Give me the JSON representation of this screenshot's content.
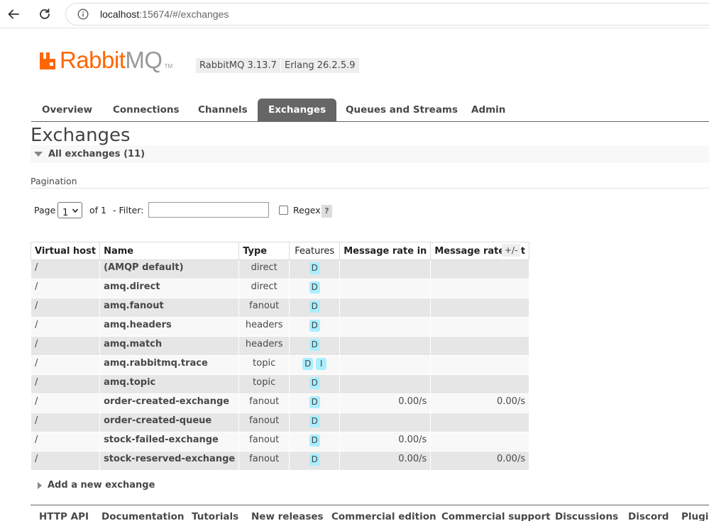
{
  "browser": {
    "url_host": "localhost",
    "url_rest": ":15674/#/exchanges"
  },
  "header": {
    "logo_rabbit": "Rabbit",
    "logo_mq": "MQ",
    "logo_tm": "TM",
    "rabbitmq_version": "RabbitMQ 3.13.7",
    "erlang_version": "Erlang 26.2.5.9"
  },
  "tabs": [
    {
      "label": "Overview"
    },
    {
      "label": "Connections"
    },
    {
      "label": "Channels"
    },
    {
      "label": "Exchanges"
    },
    {
      "label": "Queues and Streams"
    },
    {
      "label": "Admin"
    }
  ],
  "page": {
    "title": "Exchanges",
    "section_title": "All exchanges (11)",
    "pagination_label": "Pagination",
    "page_label": "Page",
    "page_value": "1",
    "of_label": "of 1",
    "filter_label": "- Filter:",
    "regex_label": "Regex",
    "help_label": "?",
    "plus_minus": "+/-",
    "add_exchange": "Add a new exchange"
  },
  "table": {
    "headers": [
      "Virtual host",
      "Name",
      "Type",
      "Features",
      "Message rate in",
      "Message rate out"
    ],
    "rows": [
      {
        "vhost": "/",
        "name": "(AMQP default)",
        "type": "direct",
        "features": [
          "D"
        ],
        "rate_in": "",
        "rate_out": ""
      },
      {
        "vhost": "/",
        "name": "amq.direct",
        "type": "direct",
        "features": [
          "D"
        ],
        "rate_in": "",
        "rate_out": ""
      },
      {
        "vhost": "/",
        "name": "amq.fanout",
        "type": "fanout",
        "features": [
          "D"
        ],
        "rate_in": "",
        "rate_out": ""
      },
      {
        "vhost": "/",
        "name": "amq.headers",
        "type": "headers",
        "features": [
          "D"
        ],
        "rate_in": "",
        "rate_out": ""
      },
      {
        "vhost": "/",
        "name": "amq.match",
        "type": "headers",
        "features": [
          "D"
        ],
        "rate_in": "",
        "rate_out": ""
      },
      {
        "vhost": "/",
        "name": "amq.rabbitmq.trace",
        "type": "topic",
        "features": [
          "D",
          "I"
        ],
        "rate_in": "",
        "rate_out": ""
      },
      {
        "vhost": "/",
        "name": "amq.topic",
        "type": "topic",
        "features": [
          "D"
        ],
        "rate_in": "",
        "rate_out": ""
      },
      {
        "vhost": "/",
        "name": "order-created-exchange",
        "type": "fanout",
        "features": [
          "D"
        ],
        "rate_in": "0.00/s",
        "rate_out": "0.00/s"
      },
      {
        "vhost": "/",
        "name": "order-created-queue",
        "type": "fanout",
        "features": [
          "D"
        ],
        "rate_in": "",
        "rate_out": ""
      },
      {
        "vhost": "/",
        "name": "stock-failed-exchange",
        "type": "fanout",
        "features": [
          "D"
        ],
        "rate_in": "0.00/s",
        "rate_out": ""
      },
      {
        "vhost": "/",
        "name": "stock-reserved-exchange",
        "type": "fanout",
        "features": [
          "D"
        ],
        "rate_in": "0.00/s",
        "rate_out": "0.00/s"
      }
    ]
  },
  "footer": {
    "links": [
      "HTTP API",
      "Documentation",
      "Tutorials",
      "New releases",
      "Commercial edition",
      "Commercial support",
      "Discussions",
      "Discord",
      "Plugins"
    ]
  },
  "colors": {
    "brand_orange": "#ff6600",
    "tab_active": "#666666",
    "feature_badge": "#aaeeff"
  }
}
